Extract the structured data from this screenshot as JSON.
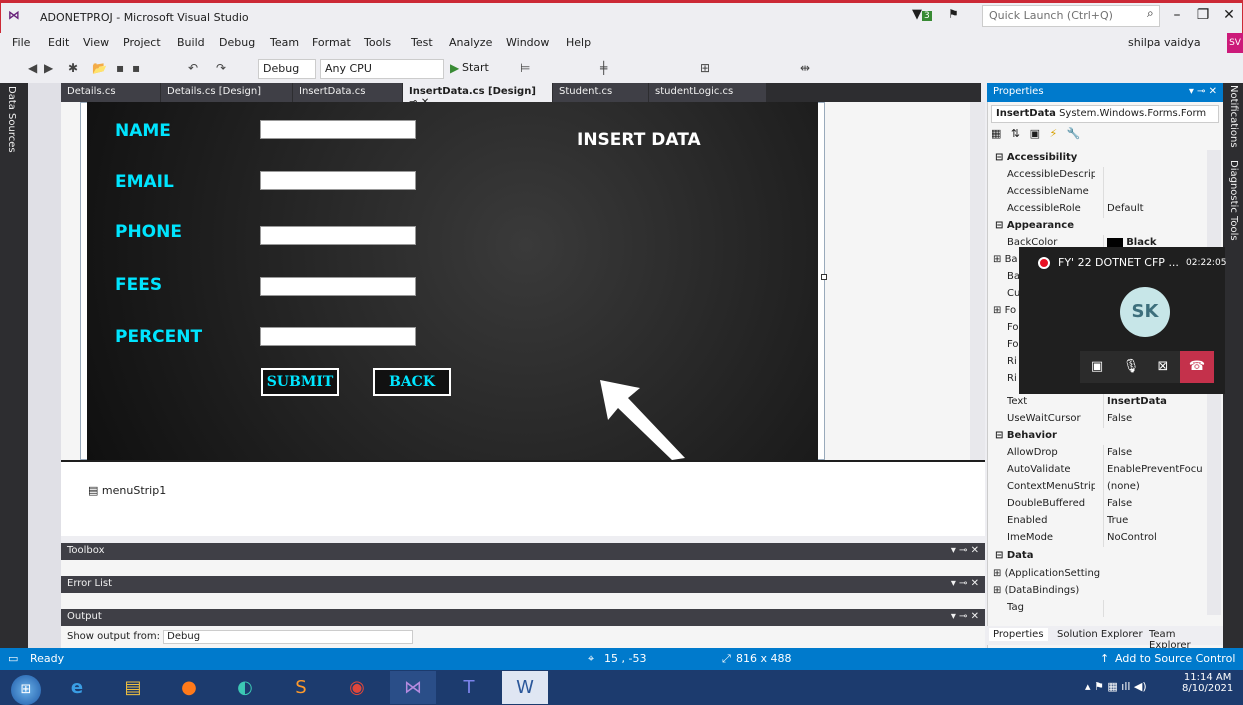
{
  "window": {
    "title": "ADONETPROJ - Microsoft Visual Studio",
    "quick_launch_placeholder": "Quick Launch (Ctrl+Q)",
    "filter_badge": "3"
  },
  "menu": [
    "File",
    "Edit",
    "View",
    "Project",
    "Build",
    "Debug",
    "Team",
    "Format",
    "Tools",
    "Test",
    "Analyze",
    "Window",
    "Help"
  ],
  "user": {
    "name": "shilpa vaidya",
    "initials": "SV"
  },
  "toolbar": {
    "config": "Debug",
    "platform": "Any CPU",
    "start_label": "Start"
  },
  "left_dock": {
    "data_sources": "Data Sources"
  },
  "doc_tabs": [
    "Details.cs",
    "Details.cs [Design]",
    "InsertData.cs",
    "InsertData.cs [Design]",
    "Student.cs",
    "studentLogic.cs"
  ],
  "form": {
    "labels": [
      "NAME",
      "EMAIL",
      "PHONE",
      "FEES",
      "PERCENT"
    ],
    "title": "INSERT DATA",
    "submit": "SUBMIT",
    "back": "BACK"
  },
  "tray": {
    "menustrip": "menuStrip1"
  },
  "panels": {
    "toolbox": "Toolbox",
    "error_list": "Error List",
    "output": "Output",
    "output_from_label": "Show output from:",
    "output_from_value": "Debug"
  },
  "properties": {
    "header": "Properties",
    "object": "InsertData",
    "object_type": "System.Windows.Forms.Form",
    "categories": {
      "accessibility": "Accessibility",
      "appearance": "Appearance",
      "behavior": "Behavior",
      "data": "Data"
    },
    "rows_accessibility": [
      {
        "name": "AccessibleDescripti",
        "value": ""
      },
      {
        "name": "AccessibleName",
        "value": ""
      },
      {
        "name": "AccessibleRole",
        "value": "Default"
      }
    ],
    "backcolor": {
      "name": "BackColor",
      "value": "Black"
    },
    "partial_rows": [
      "Ba",
      "Ba",
      "Cu",
      "Fo",
      "Fo",
      "Fo",
      "Ri",
      "Ri"
    ],
    "rows_appearance_tail": [
      {
        "name": "Text",
        "value": "InsertData"
      },
      {
        "name": "UseWaitCursor",
        "value": "False"
      }
    ],
    "rows_behavior": [
      {
        "name": "AllowDrop",
        "value": "False"
      },
      {
        "name": "AutoValidate",
        "value": "EnablePreventFocusC"
      },
      {
        "name": "ContextMenuStrip",
        "value": "(none)"
      },
      {
        "name": "DoubleBuffered",
        "value": "False"
      },
      {
        "name": "Enabled",
        "value": "True"
      },
      {
        "name": "ImeMode",
        "value": "NoControl"
      }
    ],
    "rows_data": [
      {
        "name": "(ApplicationSetting",
        "value": ""
      },
      {
        "name": "(DataBindings)",
        "value": ""
      },
      {
        "name": "Tag",
        "value": ""
      }
    ],
    "tabs": [
      "Properties",
      "Solution Explorer",
      "Team Explorer"
    ]
  },
  "right_dock": {
    "notifications": "Notifications",
    "diagnostic": "Diagnostic Tools"
  },
  "call": {
    "title": "FY' 22 DOTNET CFP ...",
    "time": "02:22:05",
    "initials": "SK"
  },
  "status": {
    "ready": "Ready",
    "position": "15 , -53",
    "size": "816 x 488",
    "source_control": "Add to Source Control"
  },
  "clock": {
    "time": "11:14 AM",
    "date": "8/10/2021"
  },
  "colors": {
    "accent": "#007acc",
    "form_label": "#00e5ff",
    "title_border": "#cc2936"
  }
}
